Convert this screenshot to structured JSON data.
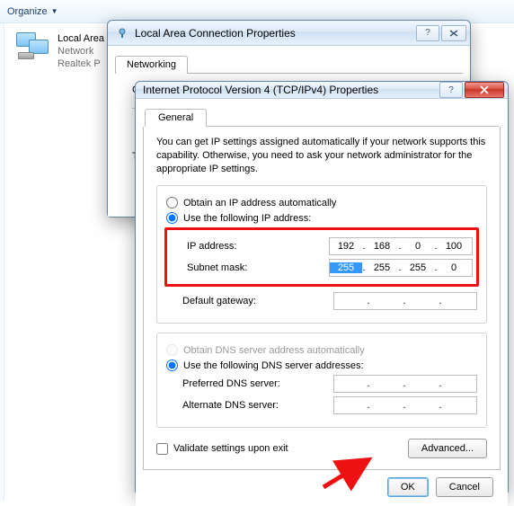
{
  "explorer": {
    "organize": "Organize"
  },
  "connection": {
    "nameFragment": "Local Area",
    "line2Fragment": "Network",
    "line3Fragment": "Realtek P"
  },
  "lanWindow": {
    "title": "Local Area Connection Properties",
    "tab": "Networking",
    "connectPrefix": "Con",
    "thisLabel": "T"
  },
  "ipv4Window": {
    "title": "Internet Protocol Version 4 (TCP/IPv4) Properties",
    "tab": "General",
    "description": "You can get IP settings assigned automatically if your network supports this capability. Otherwise, you need to ask your network administrator for the appropriate IP settings.",
    "radioAuto": "Obtain an IP address automatically",
    "radioManual": "Use the following IP address:",
    "ipLabel": "IP address:",
    "subnetLabel": "Subnet mask:",
    "gatewayLabel": "Default gateway:",
    "ip": {
      "o1": "192",
      "o2": "168",
      "o3": "0",
      "o4": "100"
    },
    "subnet": {
      "o1": "255",
      "o2": "255",
      "o3": "255",
      "o4": "0"
    },
    "gateway": {
      "o1": "",
      "o2": "",
      "o3": "",
      "o4": ""
    },
    "radioDnsAuto": "Obtain DNS server address automatically",
    "radioDnsManual": "Use the following DNS server addresses:",
    "prefDnsLabel": "Preferred DNS server:",
    "altDnsLabel": "Alternate DNS server:",
    "prefDns": {
      "o1": "",
      "o2": "",
      "o3": "",
      "o4": ""
    },
    "altDns": {
      "o1": "",
      "o2": "",
      "o3": "",
      "o4": ""
    },
    "validate": "Validate settings upon exit",
    "advanced": "Advanced...",
    "ok": "OK",
    "cancel": "Cancel"
  }
}
